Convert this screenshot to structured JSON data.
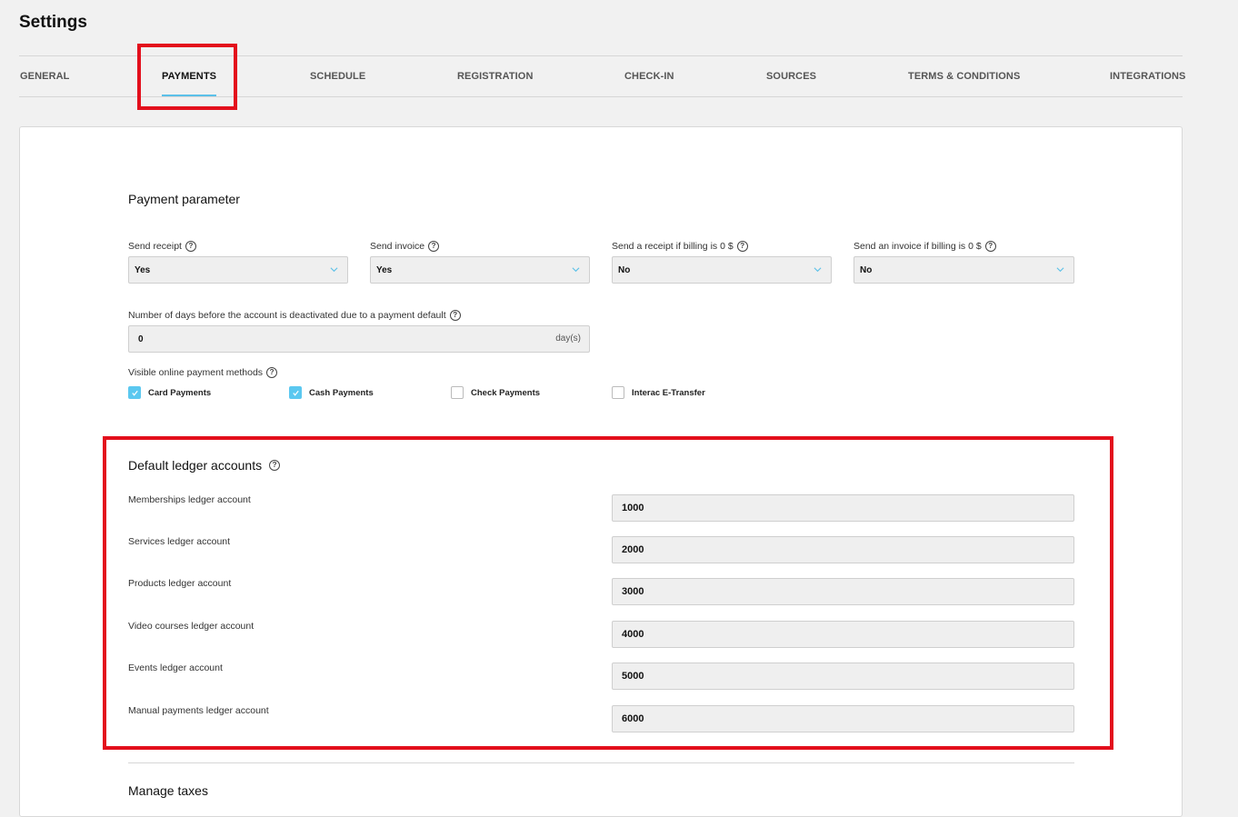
{
  "page": {
    "title": "Settings"
  },
  "tabs": [
    {
      "label": "GENERAL"
    },
    {
      "label": "PAYMENTS"
    },
    {
      "label": "SCHEDULE"
    },
    {
      "label": "REGISTRATION"
    },
    {
      "label": "CHECK-IN"
    },
    {
      "label": "SOURCES"
    },
    {
      "label": "TERMS & CONDITIONS"
    },
    {
      "label": "INTEGRATIONS"
    }
  ],
  "active_tab": "PAYMENTS",
  "payment_parameter": {
    "title": "Payment parameter",
    "selects": [
      {
        "label": "Send receipt",
        "value": "Yes"
      },
      {
        "label": "Send invoice",
        "value": "Yes"
      },
      {
        "label": "Send a receipt if billing is 0 $",
        "value": "No"
      },
      {
        "label": "Send an invoice if billing is 0 $",
        "value": "No"
      }
    ],
    "deactivation": {
      "label": "Number of days before the account is deactivated due to a payment default",
      "value": "0",
      "suffix": "day(s)"
    },
    "methods": {
      "label": "Visible online payment methods",
      "items": [
        {
          "label": "Card Payments",
          "checked": true
        },
        {
          "label": "Cash Payments",
          "checked": true
        },
        {
          "label": "Check Payments",
          "checked": false
        },
        {
          "label": "Interac E-Transfer",
          "checked": false
        }
      ]
    }
  },
  "ledger": {
    "title": "Default ledger accounts",
    "accounts": [
      {
        "label": "Memberships ledger account",
        "value": "1000"
      },
      {
        "label": "Services ledger account",
        "value": "2000"
      },
      {
        "label": "Products ledger account",
        "value": "3000"
      },
      {
        "label": "Video courses ledger account",
        "value": "4000"
      },
      {
        "label": "Events ledger account",
        "value": "5000"
      },
      {
        "label": "Manual payments ledger account",
        "value": "6000"
      }
    ]
  },
  "taxes": {
    "title": "Manage taxes"
  },
  "colors": {
    "accent": "#5bc0e8",
    "highlight": "#e30f1c"
  }
}
